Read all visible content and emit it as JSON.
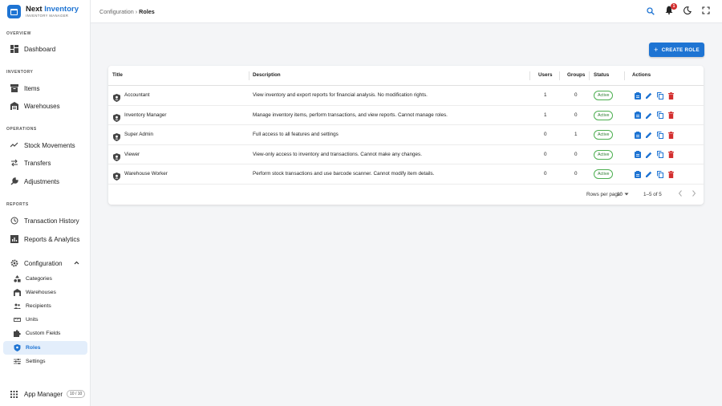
{
  "brand": {
    "name_part1": "Next",
    "name_part2": "Inventory",
    "subtitle": "INVENTORY MANAGER"
  },
  "sidebar": {
    "sections": {
      "overview": "OVERVIEW",
      "inventory": "INVENTORY",
      "operations": "OPERATIONS",
      "reports": "REPORTS"
    },
    "items": {
      "dashboard": "Dashboard",
      "items": "Items",
      "warehouses": "Warehouses",
      "stock_movements": "Stock Movements",
      "transfers": "Transfers",
      "adjustments": "Adjustments",
      "transaction_history": "Transaction History",
      "reports_analytics": "Reports & Analytics",
      "configuration": "Configuration"
    },
    "config_items": {
      "categories": "Categories",
      "warehouses": "Warehouses",
      "recipients": "Recipients",
      "units": "Units",
      "custom_fields": "Custom Fields",
      "roles": "Roles",
      "settings": "Settings"
    },
    "app_manager": {
      "label": "App Manager",
      "badge": "10 / 10"
    }
  },
  "topbar": {
    "breadcrumb_parent": "Configuration",
    "breadcrumb_sep": "›",
    "breadcrumb_current": "Roles",
    "notification_count": "1"
  },
  "create_button": {
    "label": "CREATE ROLE"
  },
  "table": {
    "headers": {
      "title": "Title",
      "description": "Description",
      "users": "Users",
      "groups": "Groups",
      "status": "Status",
      "actions": "Actions"
    },
    "rows": [
      {
        "title": "Accountant",
        "description": "View inventory and export reports for financial analysis. No modification rights.",
        "users": "1",
        "groups": "0",
        "status": "Active"
      },
      {
        "title": "Inventory Manager",
        "description": "Manage inventory items, perform transactions, and view reports. Cannot manage roles.",
        "users": "1",
        "groups": "0",
        "status": "Active"
      },
      {
        "title": "Super Admin",
        "description": "Full access to all features and settings",
        "users": "0",
        "groups": "1",
        "status": "Active"
      },
      {
        "title": "Viewer",
        "description": "View-only access to inventory and transactions. Cannot make any changes.",
        "users": "0",
        "groups": "0",
        "status": "Active"
      },
      {
        "title": "Warehouse Worker",
        "description": "Perform stock transactions and use barcode scanner. Cannot modify item details.",
        "users": "0",
        "groups": "0",
        "status": "Active"
      }
    ],
    "footer": {
      "rows_per_page_label": "Rows per page:",
      "rows_per_page_value": "10",
      "range": "1–5 of 5"
    }
  },
  "colors": {
    "accent": "#1e74d3",
    "status_active": "#4caf50",
    "delete": "#d32f2f",
    "notification": "#d32f2f"
  }
}
